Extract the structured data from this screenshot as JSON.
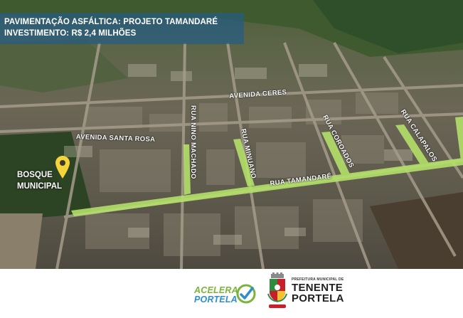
{
  "banner": {
    "line1": "PAVIMENTAÇÃO ASFÁLTICA: PROJETO TAMANDARÉ",
    "line2": "INVESTIMENTO: R$ 2,4 MILHÕES"
  },
  "streets": {
    "avenida_ceres": "AVENIDA CERES",
    "avenida_santa_rosa": "AVENIDA SANTA ROSA",
    "rua_nino_machado": "RUA NINO MACHADO",
    "rua_minuano": "RUA MINUANO",
    "rua_coroados": "RUA COROADOS",
    "rua_calapalos": "RUA CALAPALOS",
    "rua_tamandare": "RUA TAMANDARÉ"
  },
  "poi": {
    "line1": "BOSQUE",
    "line2": "MUNICIPAL",
    "icon": "location-pin-icon",
    "pin_color": "#f5d33a"
  },
  "highlight_color": "#b5e36a",
  "logos": {
    "acelera_line1": "ACELERA",
    "acelera_line2": "PORTELA",
    "acelera_color_green": "#7bb43a",
    "acelera_color_blue": "#2f8fc8",
    "prefeitura_small": "PREFEITURA MUNICIPAL DE",
    "prefeitura_line1": "TENENTE",
    "prefeitura_line2": "PORTELA"
  }
}
